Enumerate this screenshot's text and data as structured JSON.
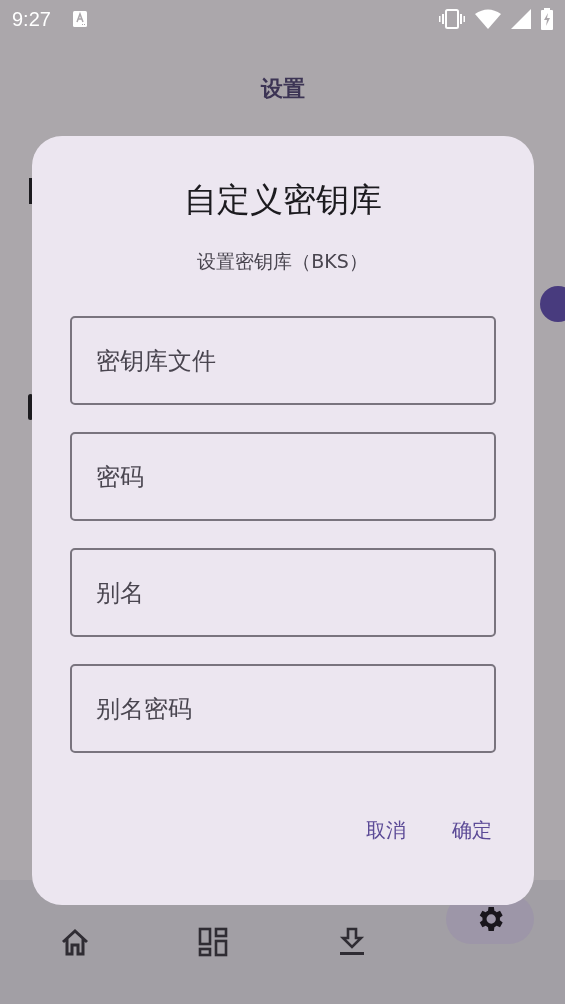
{
  "status_bar": {
    "time": "9:27"
  },
  "page": {
    "title": "设置"
  },
  "dialog": {
    "title": "自定义密钥库",
    "subtitle": "设置密钥库（BKS）",
    "fields": [
      {
        "placeholder": "密钥库文件"
      },
      {
        "placeholder": "密码"
      },
      {
        "placeholder": "别名"
      },
      {
        "placeholder": "别名密码"
      }
    ],
    "buttons": [
      "取消",
      "确定"
    ]
  },
  "bottom_nav": [
    {
      "selected": false
    },
    {
      "selected": false
    },
    {
      "selected": false
    },
    {
      "selected": true
    }
  ]
}
